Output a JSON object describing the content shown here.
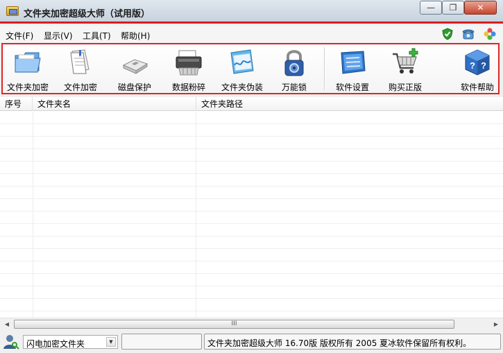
{
  "window": {
    "title": "文件夹加密超级大师（试用版）",
    "minimize_label": "—",
    "restore_label": "❐",
    "close_label": "✕"
  },
  "menu": {
    "items": [
      {
        "label": "文件(F)"
      },
      {
        "label": "显示(V)"
      },
      {
        "label": "工具(T)"
      },
      {
        "label": "帮助(H)"
      }
    ],
    "right_icons": [
      "shield-check-icon",
      "telephone-icon",
      "flower-icon"
    ]
  },
  "toolbar": {
    "buttons": [
      {
        "label": "文件夹加密",
        "icon": "folder-icon"
      },
      {
        "label": "文件加密",
        "icon": "document-icon"
      },
      {
        "label": "磁盘保护",
        "icon": "usb-drive-icon"
      },
      {
        "label": "数据粉碎",
        "icon": "shredder-icon"
      },
      {
        "label": "文件夹伪装",
        "icon": "disguise-folder-icon"
      },
      {
        "label": "万能锁",
        "icon": "padlock-icon"
      },
      {
        "label": "软件设置",
        "icon": "settings-panel-icon"
      },
      {
        "label": "购买正版",
        "icon": "shopping-cart-icon"
      },
      {
        "label": "软件帮助",
        "icon": "help-cube-icon"
      }
    ]
  },
  "list": {
    "columns": [
      "序号",
      "文件夹名",
      "文件夹路径"
    ],
    "rows": []
  },
  "scrollbar": {
    "thumb_grip": "III"
  },
  "status": {
    "mode_select_value": "闪电加密文件夹",
    "copyright": "文件夹加密超级大师 16.70版 版权所有 2005 夏冰软件保留所有权利。"
  },
  "colors": {
    "accent_red": "#e02424",
    "title_gradient_top": "#dfe6ee",
    "close_red": "#c9452e"
  }
}
